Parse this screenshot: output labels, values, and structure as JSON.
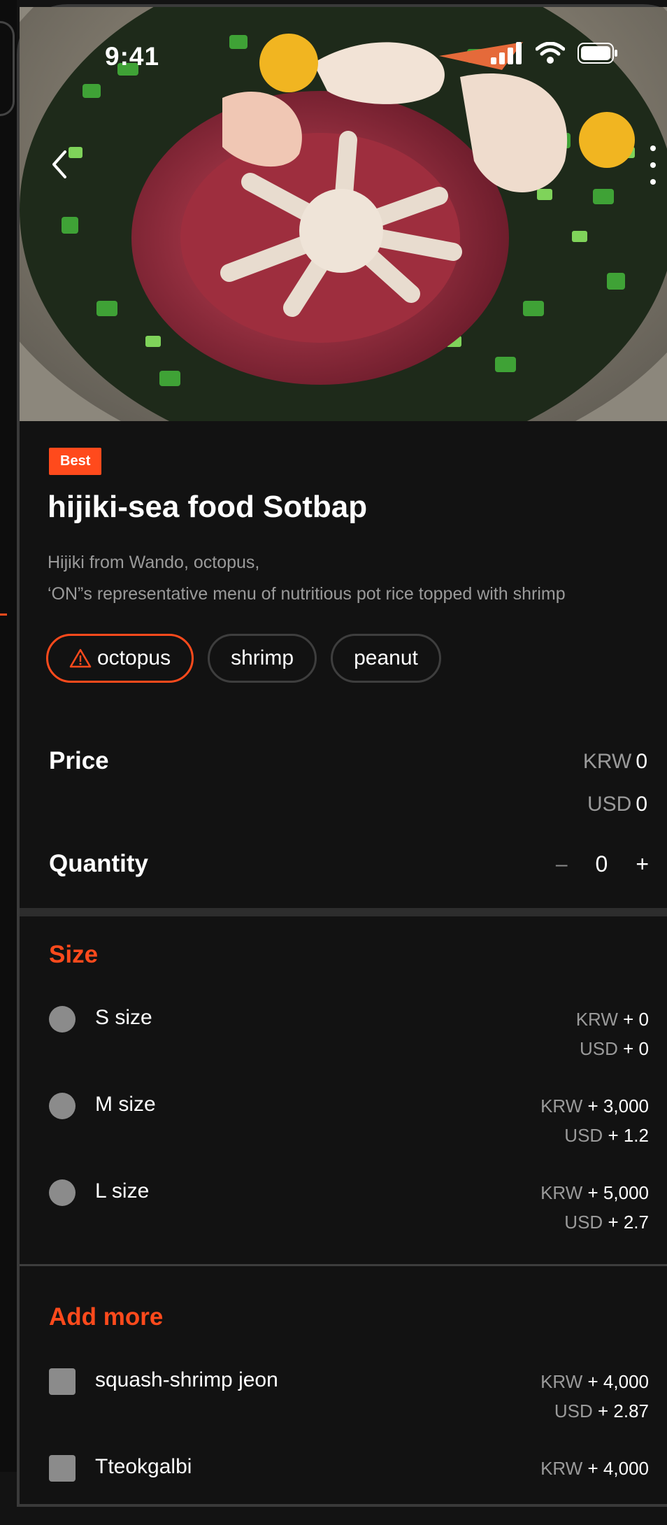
{
  "status_bar": {
    "time": "9:41"
  },
  "product": {
    "badge": "Best",
    "title": "hijiki-sea food Sotbap",
    "description_line1": "Hijiki from Wando, octopus,",
    "description_line2": "‘ON”s representative menu of nutritious pot rice topped with shrimp",
    "tags": [
      {
        "label": "octopus",
        "warning": true
      },
      {
        "label": "shrimp",
        "warning": false
      },
      {
        "label": "peanut",
        "warning": false
      }
    ]
  },
  "price": {
    "label": "Price",
    "krw_currency": "KRW",
    "krw_value": "0",
    "usd_currency": "USD",
    "usd_value": "0"
  },
  "quantity": {
    "label": "Quantity",
    "value": "0",
    "minus": "–",
    "plus": "+"
  },
  "size": {
    "title": "Size",
    "options": [
      {
        "label": "S size",
        "krw": "KRW",
        "krw_add": "+ 0",
        "usd": "USD",
        "usd_add": "+ 0"
      },
      {
        "label": "M size",
        "krw": "KRW",
        "krw_add": "+ 3,000",
        "usd": "USD",
        "usd_add": "+ 1.2"
      },
      {
        "label": "L size",
        "krw": "KRW",
        "krw_add": "+ 5,000",
        "usd": "USD",
        "usd_add": "+ 2.7"
      }
    ]
  },
  "add_more": {
    "title": "Add more",
    "options": [
      {
        "label": "squash-shrimp jeon",
        "krw": "KRW",
        "krw_add": "+ 4,000",
        "usd": "USD",
        "usd_add": "+ 2.87"
      },
      {
        "label": "Tteokgalbi",
        "krw": "KRW",
        "krw_add": "+ 4,000"
      }
    ]
  },
  "colors": {
    "accent": "#ff4a1c",
    "background": "#121212",
    "muted": "#9a9a9a"
  }
}
